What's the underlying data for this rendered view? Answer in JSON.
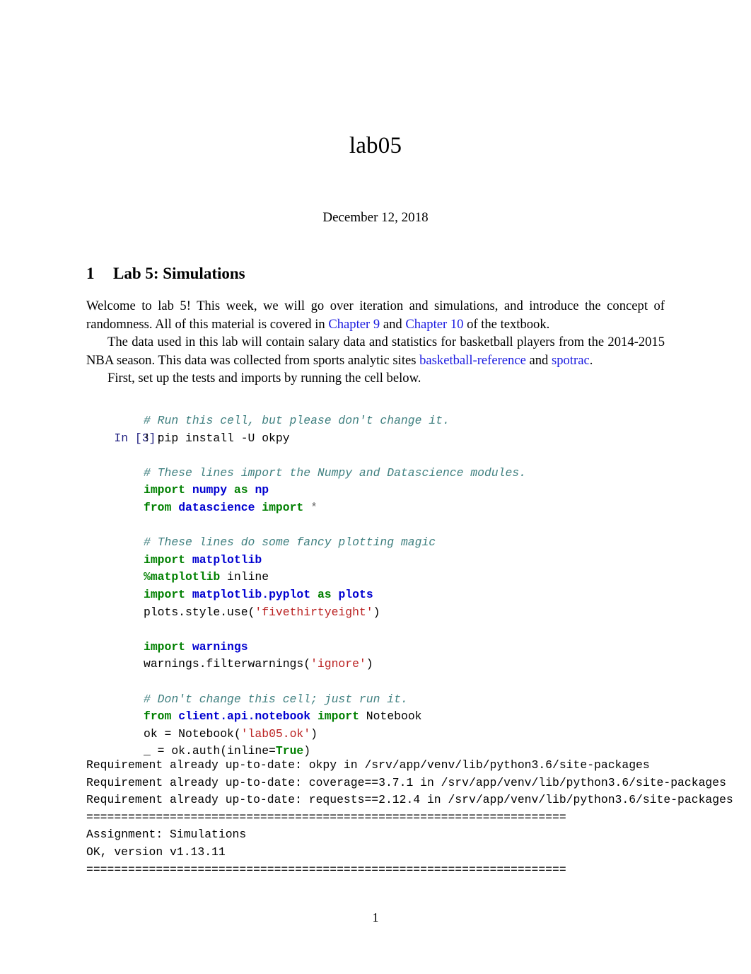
{
  "document": {
    "title": "lab05",
    "date": "December 12, 2018",
    "page_number": "1"
  },
  "section": {
    "number": "1",
    "heading": "Lab 5: Simulations"
  },
  "paragraphs": {
    "p1_a": "Welcome to lab 5! This week, we will go over iteration and simulations, and introduce the concept of randomness. All of this material is covered in ",
    "p1_link1": "Chapter 9",
    "p1_b": " and ",
    "p1_link2": "Chapter 10",
    "p1_c": " of the textbook.",
    "p2_a": "The data used in this lab will contain salary data and statistics for basketball players from the 2014-2015 NBA season. This data was collected from sports analytic sites ",
    "p2_link1": "basketball-reference",
    "p2_b": " and ",
    "p2_link2": "spotrac",
    "p2_c": ".",
    "p3": "First, set up the tests and imports by running the cell below."
  },
  "code_cell": {
    "prompt": "In [3]:",
    "lines": [
      {
        "tokens": [
          {
            "t": "comment",
            "s": "# Run this cell, but please don't change it."
          }
        ]
      },
      {
        "tokens": [
          {
            "t": "plain",
            "s": "! pip install -U okpy"
          }
        ]
      },
      {
        "tokens": [
          {
            "t": "plain",
            "s": ""
          }
        ]
      },
      {
        "tokens": [
          {
            "t": "comment",
            "s": "# These lines import the Numpy and Datascience modules."
          }
        ]
      },
      {
        "tokens": [
          {
            "t": "kw",
            "s": "import"
          },
          {
            "t": "plain",
            "s": " "
          },
          {
            "t": "mod",
            "s": "numpy"
          },
          {
            "t": "plain",
            "s": " "
          },
          {
            "t": "kw",
            "s": "as"
          },
          {
            "t": "plain",
            "s": " "
          },
          {
            "t": "mod",
            "s": "np"
          }
        ]
      },
      {
        "tokens": [
          {
            "t": "kw",
            "s": "from"
          },
          {
            "t": "plain",
            "s": " "
          },
          {
            "t": "mod",
            "s": "datascience"
          },
          {
            "t": "plain",
            "s": " "
          },
          {
            "t": "kw",
            "s": "import"
          },
          {
            "t": "plain",
            "s": " "
          },
          {
            "t": "op",
            "s": "*"
          }
        ]
      },
      {
        "tokens": [
          {
            "t": "plain",
            "s": ""
          }
        ]
      },
      {
        "tokens": [
          {
            "t": "comment",
            "s": "# These lines do some fancy plotting magic"
          }
        ]
      },
      {
        "tokens": [
          {
            "t": "kw",
            "s": "import"
          },
          {
            "t": "plain",
            "s": " "
          },
          {
            "t": "mod",
            "s": "matplotlib"
          }
        ]
      },
      {
        "tokens": [
          {
            "t": "kw",
            "s": "%matplotlib"
          },
          {
            "t": "plain",
            "s": " inline"
          }
        ]
      },
      {
        "tokens": [
          {
            "t": "kw",
            "s": "import"
          },
          {
            "t": "plain",
            "s": " "
          },
          {
            "t": "mod",
            "s": "matplotlib.pyplot"
          },
          {
            "t": "plain",
            "s": " "
          },
          {
            "t": "kw",
            "s": "as"
          },
          {
            "t": "plain",
            "s": " "
          },
          {
            "t": "mod",
            "s": "plots"
          }
        ]
      },
      {
        "tokens": [
          {
            "t": "plain",
            "s": "plots.style.use("
          },
          {
            "t": "str",
            "s": "'fivethirtyeight'"
          },
          {
            "t": "plain",
            "s": ")"
          }
        ]
      },
      {
        "tokens": [
          {
            "t": "plain",
            "s": ""
          }
        ]
      },
      {
        "tokens": [
          {
            "t": "kw",
            "s": "import"
          },
          {
            "t": "plain",
            "s": " "
          },
          {
            "t": "mod",
            "s": "warnings"
          }
        ]
      },
      {
        "tokens": [
          {
            "t": "plain",
            "s": "warnings.filterwarnings("
          },
          {
            "t": "str",
            "s": "'ignore'"
          },
          {
            "t": "plain",
            "s": ")"
          }
        ]
      },
      {
        "tokens": [
          {
            "t": "plain",
            "s": ""
          }
        ]
      },
      {
        "tokens": [
          {
            "t": "comment",
            "s": "# Don't change this cell; just run it."
          }
        ]
      },
      {
        "tokens": [
          {
            "t": "kw",
            "s": "from"
          },
          {
            "t": "plain",
            "s": " "
          },
          {
            "t": "mod",
            "s": "client.api.notebook"
          },
          {
            "t": "plain",
            "s": " "
          },
          {
            "t": "kw",
            "s": "import"
          },
          {
            "t": "plain",
            "s": " Notebook"
          }
        ]
      },
      {
        "tokens": [
          {
            "t": "plain",
            "s": "ok = Notebook("
          },
          {
            "t": "str",
            "s": "'lab05.ok'"
          },
          {
            "t": "plain",
            "s": ")"
          }
        ]
      },
      {
        "tokens": [
          {
            "t": "plain",
            "s": "_ = ok.auth(inline="
          },
          {
            "t": "const",
            "s": "True"
          },
          {
            "t": "plain",
            "s": ")"
          }
        ]
      }
    ]
  },
  "output_stream": {
    "lines": [
      "Requirement already up-to-date: okpy in /srv/app/venv/lib/python3.6/site-packages",
      "Requirement already up-to-date: coverage==3.7.1 in /srv/app/venv/lib/python3.6/site-packages",
      "Requirement already up-to-date: requests==2.12.4 in /srv/app/venv/lib/python3.6/site-packages",
      "=====================================================================",
      "Assignment: Simulations",
      "OK, version v1.13.11",
      "====================================================================="
    ]
  },
  "colors": {
    "link": "#1a1ae0",
    "prompt": "#202080",
    "comment": "#408080",
    "keyword": "#008000",
    "module": "#0000d0",
    "string": "#ba2121"
  }
}
